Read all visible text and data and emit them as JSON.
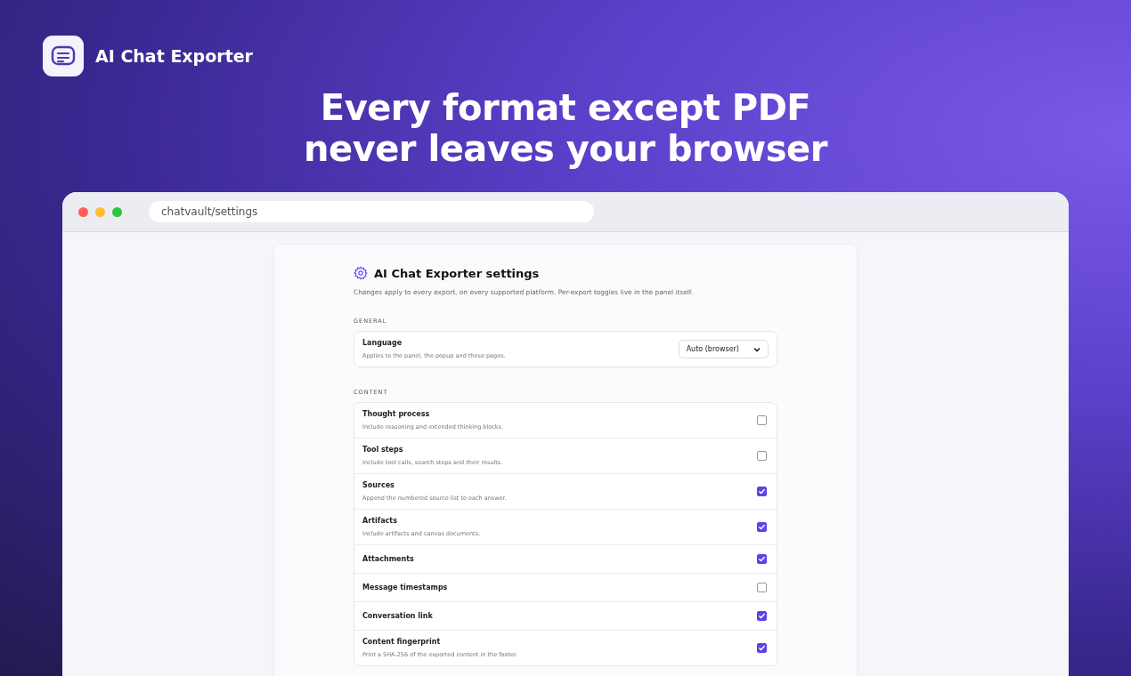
{
  "brand": {
    "name": "AI Chat Exporter"
  },
  "headline": [
    "Every format except PDF",
    "never leaves your browser"
  ],
  "browser": {
    "address": "chatvault/settings"
  },
  "settings": {
    "title": "AI Chat Exporter settings",
    "intro": "Changes apply to every export, on every supported platform. Per-export toggles live in the panel itself.",
    "sections": [
      {
        "heading": "GENERAL",
        "rows": [
          {
            "kind": "select",
            "label": "Language",
            "description": "Applies to the panel, the popup and these pages.",
            "value": "Auto (browser)"
          }
        ]
      },
      {
        "heading": "CONTENT",
        "rows": [
          {
            "kind": "checkbox",
            "label": "Thought process",
            "description": "Include reasoning and extended thinking blocks.",
            "checked": false
          },
          {
            "kind": "checkbox",
            "label": "Tool steps",
            "description": "Include tool calls, search steps and their results.",
            "checked": false
          },
          {
            "kind": "checkbox",
            "label": "Sources",
            "description": "Append the numbered source list to each answer.",
            "checked": true
          },
          {
            "kind": "checkbox",
            "label": "Artifacts",
            "description": "Include artifacts and canvas documents.",
            "checked": true
          },
          {
            "kind": "checkbox",
            "label": "Attachments",
            "checked": true
          },
          {
            "kind": "checkbox",
            "label": "Message timestamps",
            "checked": false
          },
          {
            "kind": "checkbox",
            "label": "Conversation link",
            "checked": true
          },
          {
            "kind": "checkbox",
            "label": "Content fingerprint",
            "description": "Print a SHA-256 of the exported content in the footer.",
            "checked": true
          }
        ]
      }
    ]
  }
}
